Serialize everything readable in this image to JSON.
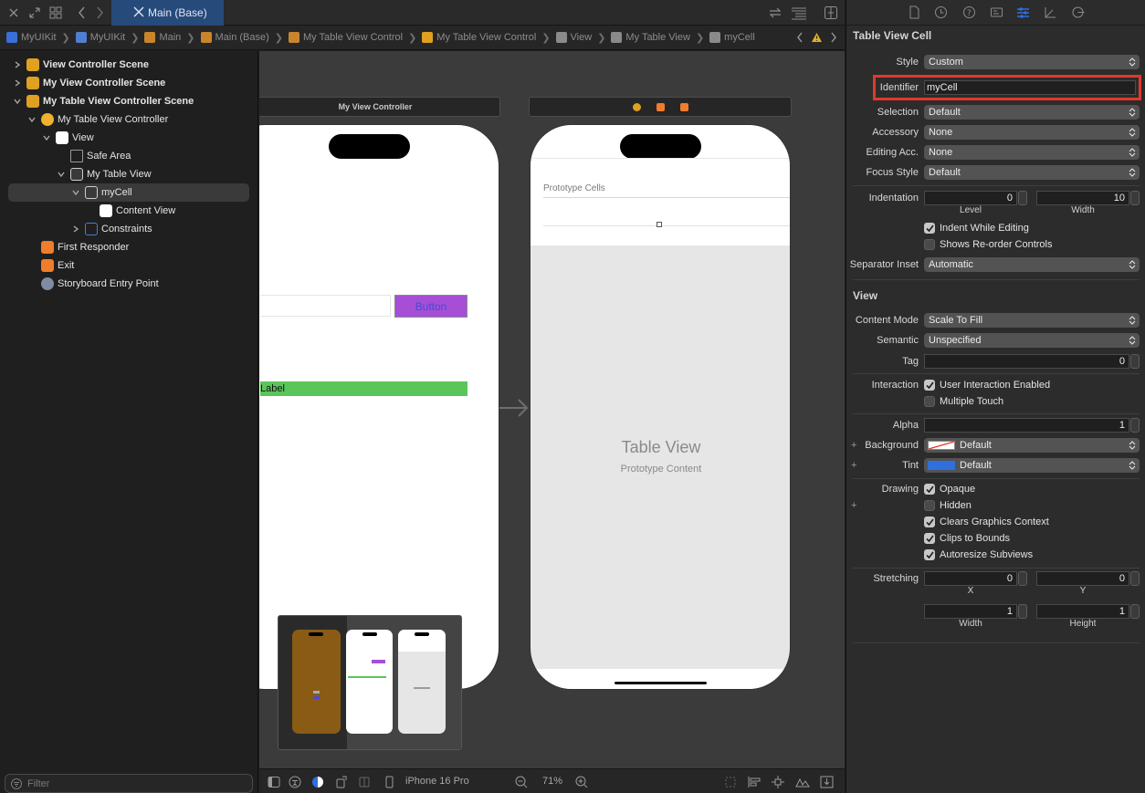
{
  "toolbar": {
    "tab_title": "Main (Base)",
    "icons": [
      "close-icon",
      "expand-icon",
      "grid-icon",
      "chevron-left-icon",
      "chevron-right-icon",
      "refresh-icon",
      "lines-icon",
      "split-icon"
    ]
  },
  "breadcrumb": {
    "items": [
      {
        "label": "MyUIKit",
        "icon": "app-icon",
        "color": "#3b6fd8"
      },
      {
        "label": "MyUIKit",
        "icon": "folder-icon",
        "color": "#4f7fd0"
      },
      {
        "label": "Main",
        "icon": "storyboard-icon",
        "color": "#c9852b"
      },
      {
        "label": "Main (Base)",
        "icon": "storyboard-icon",
        "color": "#c9852b"
      },
      {
        "label": "My Table View Control",
        "icon": "scene-icon",
        "color": "#c9852b"
      },
      {
        "label": "My Table View Control",
        "icon": "controller-icon",
        "color": "#e0a020"
      },
      {
        "label": "View",
        "icon": "view-icon",
        "color": "#8a8a8a"
      },
      {
        "label": "My Table View",
        "icon": "tableview-icon",
        "color": "#8a8a8a"
      },
      {
        "label": "myCell",
        "icon": "cell-icon",
        "color": "#8a8a8a"
      }
    ],
    "warning_icon": "warning-icon"
  },
  "navigator": {
    "rows": [
      {
        "label": "View Controller Scene",
        "bold": true,
        "disclosure": "closed",
        "icon": "scene-icon"
      },
      {
        "label": "My View Controller Scene",
        "bold": true,
        "disclosure": "closed",
        "icon": "scene-icon"
      },
      {
        "label": "My Table View Controller Scene",
        "bold": true,
        "disclosure": "open",
        "icon": "scene-icon"
      },
      {
        "label": "My Table View Controller",
        "bold": false,
        "disclosure": "open",
        "icon": "controller-icon"
      },
      {
        "label": "View",
        "bold": false,
        "disclosure": "open",
        "icon": "view-icon"
      },
      {
        "label": "Safe Area",
        "bold": false,
        "disclosure": "none",
        "icon": "safe-area-icon"
      },
      {
        "label": "My Table View",
        "bold": false,
        "disclosure": "open",
        "icon": "tableview-icon"
      },
      {
        "label": "myCell",
        "bold": false,
        "disclosure": "open",
        "icon": "cell-icon",
        "selected": true
      },
      {
        "label": "Content View",
        "bold": false,
        "disclosure": "none",
        "icon": "content-view-icon"
      },
      {
        "label": "Constraints",
        "bold": false,
        "disclosure": "closed",
        "icon": "constraints-icon"
      },
      {
        "label": "First Responder",
        "bold": false,
        "disclosure": "none",
        "icon": "first-responder-icon"
      },
      {
        "label": "Exit",
        "bold": false,
        "disclosure": "none",
        "icon": "exit-icon"
      },
      {
        "label": "Storyboard Entry Point",
        "bold": false,
        "disclosure": "none",
        "icon": "entry-point-icon"
      }
    ],
    "filter_placeholder": "Filter"
  },
  "canvas": {
    "vc1_title": "My View Controller",
    "button_label": "Button",
    "label_text": "Label",
    "prototype_cells": "Prototype Cells",
    "table_view_title": "Table View",
    "prototype_content": "Prototype Content"
  },
  "bottombar": {
    "device": "iPhone 16 Pro",
    "zoom": "71%"
  },
  "inspector": {
    "cell_section": "Table View Cell",
    "style_label": "Style",
    "style_value": "Custom",
    "identifier_label": "Identifier",
    "identifier_value": "myCell",
    "selection_label": "Selection",
    "selection_value": "Default",
    "accessory_label": "Accessory",
    "accessory_value": "None",
    "editing_label": "Editing Acc.",
    "editing_value": "None",
    "focus_label": "Focus Style",
    "focus_value": "Default",
    "indentation_label": "Indentation",
    "indent_level": "0",
    "indent_width": "10",
    "level_label": "Level",
    "width_label": "Width",
    "indent_while_editing": "Indent While Editing",
    "shows_reorder": "Shows Re-order Controls",
    "separator_label": "Separator Inset",
    "separator_value": "Automatic",
    "view_section": "View",
    "content_mode_label": "Content Mode",
    "content_mode_value": "Scale To Fill",
    "semantic_label": "Semantic",
    "semantic_value": "Unspecified",
    "tag_label": "Tag",
    "tag_value": "0",
    "interaction_label": "Interaction",
    "user_interaction": "User Interaction Enabled",
    "multiple_touch": "Multiple Touch",
    "alpha_label": "Alpha",
    "alpha_value": "1",
    "background_label": "Background",
    "background_value": "Default",
    "tint_label": "Tint",
    "tint_value": "Default",
    "drawing_label": "Drawing",
    "opaque": "Opaque",
    "hidden": "Hidden",
    "clears": "Clears Graphics Context",
    "clips": "Clips to Bounds",
    "autoresize": "Autoresize Subviews",
    "stretching_label": "Stretching",
    "stretch_x": "0",
    "stretch_y": "0",
    "stretch_w": "1",
    "stretch_h": "1",
    "x_label": "X",
    "y_label": "Y",
    "w_label": "Width",
    "h_label": "Height",
    "plus": "+",
    "colors": {
      "highlight": "#e0392b",
      "tint": "#2f6fde",
      "button_bg": "#a64fd6",
      "label_bg": "#5ac55a"
    }
  }
}
